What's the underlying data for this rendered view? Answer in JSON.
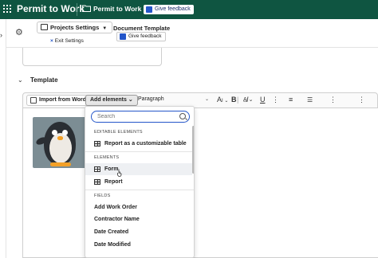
{
  "topbar": {
    "app_title": "Permit to Work",
    "breadcrumb": "Permit to Work",
    "feedback": "Give feedback",
    "icons": [
      "grid-icon",
      "folder-icon",
      "feedback-icon"
    ]
  },
  "subbar": {
    "projects_settings": "Projects Settings",
    "exit_settings": "Exit Settings",
    "document_title": "Document Template",
    "feedback": "Give feedback"
  },
  "section": {
    "label": "Template"
  },
  "toolbar": {
    "import": "Import from Word",
    "add_elements": "Add elements",
    "paragraph": "Paragraph",
    "font_size": "A",
    "bold": "B",
    "italic": "I",
    "underline": "U",
    "more": "⋮",
    "align": "≡",
    "list": "☰",
    "kebab": "⋮"
  },
  "dropdown": {
    "search_placeholder": "Search",
    "sections": {
      "editable": "EDITABLE ELEMENTS",
      "elements": "ELEMENTS",
      "fields": "FIELDS"
    },
    "editable_items": [
      "Report as a customizable table"
    ],
    "element_items": [
      "Form",
      "Report"
    ],
    "field_items": [
      "Add Work Order",
      "Contractor Name",
      "Date Created",
      "Date Modified"
    ]
  },
  "colors": {
    "topbar": "#0f5541",
    "accent": "#2456c9"
  }
}
